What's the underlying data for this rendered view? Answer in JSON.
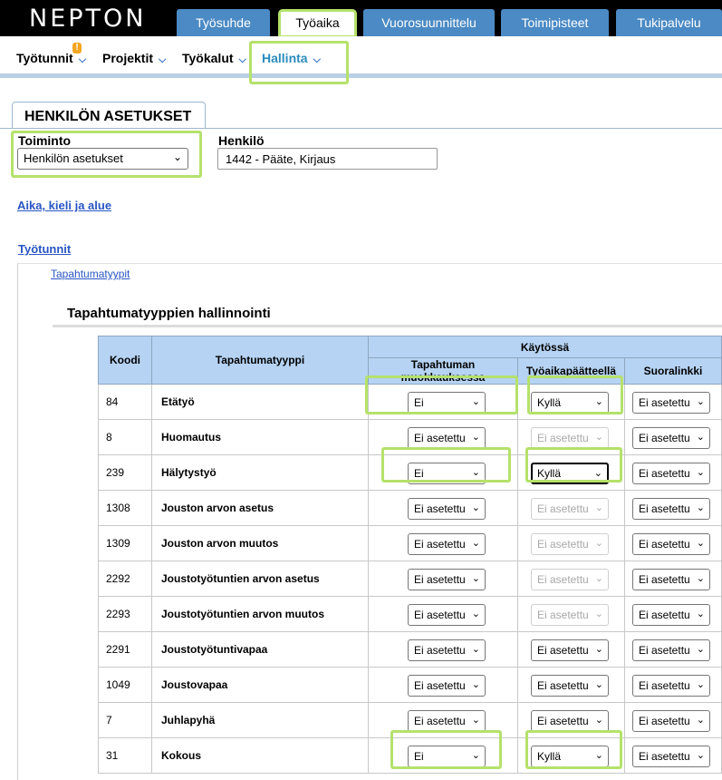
{
  "app": {
    "logo": "NEPTON"
  },
  "main_tabs": [
    {
      "label": "Työsuhde"
    },
    {
      "label": "Työaika"
    },
    {
      "label": "Vuorosuunnittelu"
    },
    {
      "label": "Toimipisteet"
    },
    {
      "label": "Tukipalvelu"
    }
  ],
  "sub_nav": [
    {
      "label": "Työtunnit",
      "badge": "!"
    },
    {
      "label": "Projektit"
    },
    {
      "label": "Työkalut"
    },
    {
      "label": "Hallinta"
    }
  ],
  "page": {
    "tab_title": "HENKILÖN ASETUKSET",
    "toiminto_label": "Toiminto",
    "toiminto_value": "Henkilön asetukset",
    "henkilo_label": "Henkilö",
    "henkilo_value": "1442 - Pääte, Kirjaus",
    "link_aika": "Aika, kieli ja alue",
    "link_tyotunnit": "Työtunnit",
    "sub_link": "Tapahtumatyypit",
    "section_title": "Tapahtumatyyppien hallinnointi"
  },
  "table": {
    "headers": {
      "code": "Koodi",
      "type": "Tapahtumatyyppi",
      "group": "Käytössä",
      "col1": "Tapahtuman muokkauksessa",
      "col2": "Työaikapäätteellä",
      "col3": "Suoralinkki"
    },
    "rows": [
      {
        "code": "84",
        "name": "Etätyö",
        "c1": "Ei",
        "c2": "Kyllä",
        "c3": "Ei asetettu"
      },
      {
        "code": "8",
        "name": "Huomautus",
        "c1": "Ei asetettu",
        "c2": "Ei asetettu",
        "c3": "Ei asetettu"
      },
      {
        "code": "239",
        "name": "Hälytystyö",
        "c1": "Ei",
        "c2": "Kyllä",
        "c3": "Ei asetettu"
      },
      {
        "code": "1308",
        "name": "Jouston arvon asetus",
        "c1": "Ei asetettu",
        "c2": "Ei asetettu",
        "c3": "Ei asetettu"
      },
      {
        "code": "1309",
        "name": "Jouston arvon muutos",
        "c1": "Ei asetettu",
        "c2": "Ei asetettu",
        "c3": "Ei asetettu"
      },
      {
        "code": "2292",
        "name": "Joustotyötuntien arvon asetus",
        "c1": "Ei asetettu",
        "c2": "Ei asetettu",
        "c3": "Ei asetettu"
      },
      {
        "code": "2293",
        "name": "Joustotyötuntien arvon muutos",
        "c1": "Ei asetettu",
        "c2": "Ei asetettu",
        "c3": "Ei asetettu"
      },
      {
        "code": "2291",
        "name": "Joustotyötuntivapaa",
        "c1": "Ei asetettu",
        "c2": "Ei asetettu",
        "c3": "Ei asetettu"
      },
      {
        "code": "1049",
        "name": "Joustovapaa",
        "c1": "Ei asetettu",
        "c2": "Ei asetettu",
        "c3": "Ei asetettu"
      },
      {
        "code": "7",
        "name": "Juhlapyhä",
        "c1": "Ei asetettu",
        "c2": "Ei asetettu",
        "c3": "Ei asetettu"
      },
      {
        "code": "31",
        "name": "Kokous",
        "c1": "Ei",
        "c2": "Kyllä",
        "c3": "Ei asetettu"
      }
    ]
  },
  "icons": {
    "dropdown": "chevron-down-icon"
  },
  "colors": {
    "tab_blue": "#4b8ac4",
    "highlight": "#b5e16b",
    "header_blue": "#b6d3f3",
    "link": "#2955c4"
  }
}
